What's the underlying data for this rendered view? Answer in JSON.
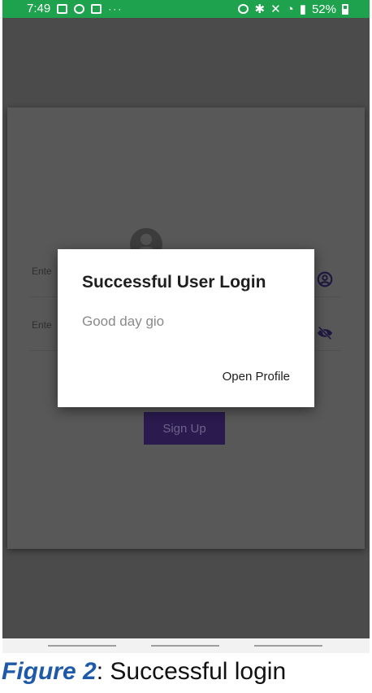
{
  "status_bar": {
    "time": "7:49",
    "left_icons": [
      "image-icon",
      "person-icon",
      "app-icon"
    ],
    "overflow": "···",
    "right_icons": [
      "alarm-icon",
      "bluetooth-icon",
      "mute-icon",
      "wifi-icon",
      "signal-icon"
    ],
    "battery": "52%"
  },
  "login_form": {
    "email_label": "Ente",
    "password_label": "Ente",
    "signup_label": "Sign Up"
  },
  "dialog": {
    "title": "Successful User Login",
    "message": "Good day gio",
    "action_label": "Open Profile"
  },
  "caption": {
    "figure_label": "Figure 2",
    "text": ": Successful login"
  },
  "colors": {
    "status_bar": "#1fa24d",
    "scrim": "#4b4b4b",
    "signup_button": "#2a1a4e",
    "caption_accent": "#1e5aa8"
  }
}
